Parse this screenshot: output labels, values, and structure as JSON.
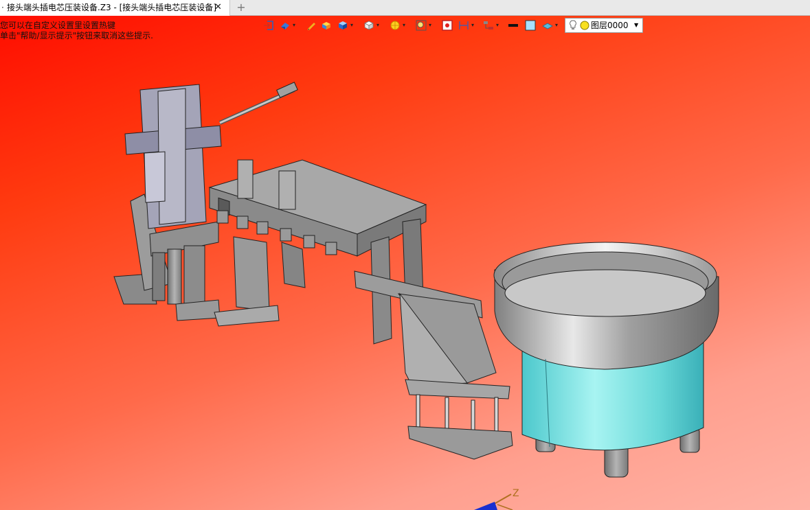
{
  "tab": {
    "title": "接头端头插电芯压装设备.Z3 - [接头端头插电芯压装设备]",
    "close_glyph": "✕",
    "new_glyph": "+"
  },
  "hints": {
    "line1": "您可以在自定义设置里设置热键",
    "line2": "单击\"帮助/显示提示\"按钮来取消这些提示."
  },
  "toolbar": {
    "icons": [
      "exit-view-icon",
      "shading-icon",
      "pen-icon",
      "solid-icon",
      "cube-blue-icon",
      "cube-white-icon",
      "render-icon",
      "zoom-fit-icon",
      "red-square-icon",
      "dimension-icon",
      "hierarchy-icon",
      "line-black-icon",
      "color-box-icon",
      "layer-plane-icon"
    ],
    "layer": {
      "value": "图层0000"
    }
  },
  "triad": {
    "axis_z": "Z"
  },
  "colors": {
    "background_top": "#ff0d00",
    "background_bottom": "#ffb3a6",
    "bowl_cyan": "#7fe0e0",
    "metal": "#9a9a9a"
  }
}
